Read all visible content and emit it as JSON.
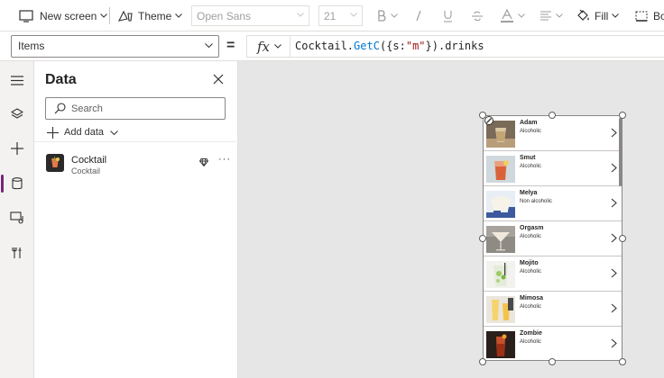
{
  "ribbon": {
    "new_screen": "New screen",
    "theme": "Theme",
    "font": "Open Sans",
    "font_size": "21",
    "fill": "Fill",
    "border_partial": "Bo"
  },
  "formula_bar": {
    "property": "Items",
    "equals": "=",
    "fx": "fx",
    "formula_object": "Cocktail.",
    "formula_function": "GetC",
    "formula_open": "({s:",
    "formula_string": "\"m\"",
    "formula_close": "}).drinks"
  },
  "data_pane": {
    "title": "Data",
    "search_placeholder": "Search",
    "add_data": "Add data",
    "source": {
      "name": "Cocktail",
      "subtitle": "Cocktail",
      "more": "···"
    }
  },
  "gallery": {
    "items": [
      {
        "title": "Adam",
        "subtitle": "Alcoholic"
      },
      {
        "title": "Smut",
        "subtitle": "Alcoholic"
      },
      {
        "title": "Melya",
        "subtitle": "Non alcoholic"
      },
      {
        "title": "Orgasm",
        "subtitle": "Alcoholic"
      },
      {
        "title": "Mojito",
        "subtitle": "Alcoholic"
      },
      {
        "title": "Mimosa",
        "subtitle": "Alcoholic"
      },
      {
        "title": "Zombie",
        "subtitle": "Alcoholic"
      }
    ]
  },
  "colors": {
    "accent": "#742774",
    "function_blue": "#0078d4",
    "string_red": "#a31515",
    "canvas_bg": "#e6e6e6"
  }
}
